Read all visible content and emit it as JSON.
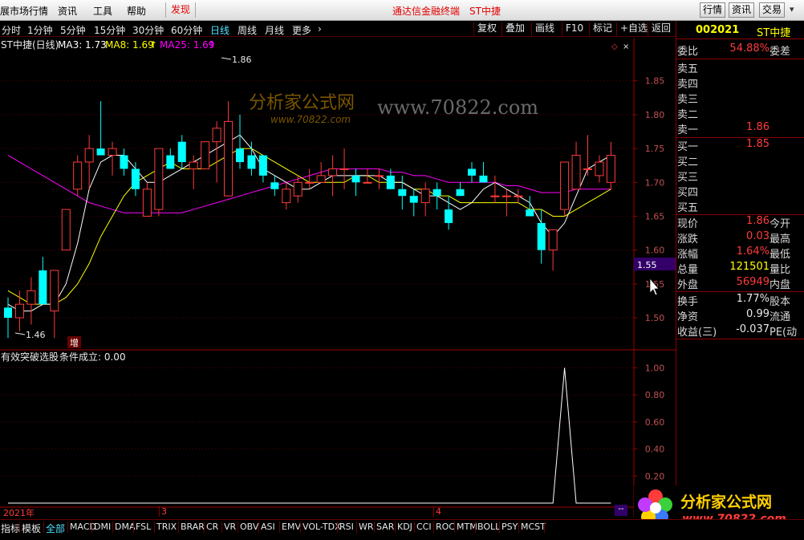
{
  "menu": {
    "items": [
      "展市场行情",
      "资讯",
      "工具",
      "帮助"
    ],
    "discover": "发现",
    "center_title": "通达信金融终端",
    "stock_tag": "ST中捷",
    "buttons": [
      "行情",
      "资讯",
      "交易"
    ]
  },
  "periods": {
    "items": [
      "分时",
      "1分钟",
      "5分钟",
      "15分钟",
      "30分钟",
      "60分钟",
      "日线",
      "周线",
      "月线",
      "更多"
    ],
    "selected": "日线",
    "more_arrow": "›"
  },
  "toolbar": {
    "items": [
      "复权",
      "叠加",
      "画线",
      "F10",
      "标记",
      "+自选",
      "返回"
    ]
  },
  "ma": {
    "title": "ST中捷(日线)",
    "ma3_label": "MA3: 1.73",
    "ma8_label": "MA8: 1.69",
    "ma25_label": "MA25: 1.69",
    "up_arrow": "↑"
  },
  "colors": {
    "up": "#ff3b3b",
    "down": "#00ffff",
    "ma3": "#ffffff",
    "ma8": "#ffff00",
    "ma25": "#ff00ff",
    "indicator": "#ffffff"
  },
  "price_axis": {
    "ticks": [
      "1.85",
      "1.80",
      "1.75",
      "1.70",
      "1.65",
      "1.60",
      "1.55",
      "1.50"
    ],
    "current_marker": "1.55"
  },
  "annotations": {
    "high": "1.86",
    "low": "1.46",
    "zeng": "增"
  },
  "watermark": {
    "text1": "分析家公式网",
    "text2": "www.70822.com",
    "text3": "www.70822.com"
  },
  "candles": [
    {
      "o": 1.515,
      "h": 1.53,
      "l": 1.47,
      "c": 1.5
    },
    {
      "o": 1.5,
      "h": 1.54,
      "l": 1.48,
      "c": 1.52
    },
    {
      "o": 1.52,
      "h": 1.56,
      "l": 1.49,
      "c": 1.54
    },
    {
      "o": 1.57,
      "h": 1.59,
      "l": 1.52,
      "c": 1.52
    },
    {
      "o": 1.51,
      "h": 1.57,
      "l": 1.47,
      "c": 1.57
    },
    {
      "o": 1.6,
      "h": 1.66,
      "l": 1.6,
      "c": 1.66
    },
    {
      "o": 1.69,
      "h": 1.74,
      "l": 1.68,
      "c": 1.73
    },
    {
      "o": 1.73,
      "h": 1.77,
      "l": 1.69,
      "c": 1.75
    },
    {
      "o": 1.75,
      "h": 1.82,
      "l": 1.74,
      "c": 1.74
    },
    {
      "o": 1.74,
      "h": 1.76,
      "l": 1.71,
      "c": 1.75
    },
    {
      "o": 1.74,
      "h": 1.75,
      "l": 1.71,
      "c": 1.72
    },
    {
      "o": 1.72,
      "h": 1.73,
      "l": 1.68,
      "c": 1.69
    },
    {
      "o": 1.65,
      "h": 1.7,
      "l": 1.65,
      "c": 1.69
    },
    {
      "o": 1.66,
      "h": 1.74,
      "l": 1.65,
      "c": 1.75
    },
    {
      "o": 1.74,
      "h": 1.75,
      "l": 1.72,
      "c": 1.72
    },
    {
      "o": 1.76,
      "h": 1.77,
      "l": 1.72,
      "c": 1.73
    },
    {
      "o": 1.72,
      "h": 1.74,
      "l": 1.69,
      "c": 1.73
    },
    {
      "o": 1.72,
      "h": 1.76,
      "l": 1.72,
      "c": 1.76
    },
    {
      "o": 1.76,
      "h": 1.79,
      "l": 1.7,
      "c": 1.78
    },
    {
      "o": 1.68,
      "h": 1.82,
      "l": 1.68,
      "c": 1.79
    },
    {
      "o": 1.75,
      "h": 1.8,
      "l": 1.72,
      "c": 1.73
    },
    {
      "o": 1.74,
      "h": 1.76,
      "l": 1.71,
      "c": 1.72
    },
    {
      "o": 1.74,
      "h": 1.74,
      "l": 1.7,
      "c": 1.71
    },
    {
      "o": 1.7,
      "h": 1.71,
      "l": 1.68,
      "c": 1.69
    },
    {
      "o": 1.67,
      "h": 1.7,
      "l": 1.66,
      "c": 1.69
    },
    {
      "o": 1.68,
      "h": 1.71,
      "l": 1.67,
      "c": 1.7
    },
    {
      "o": 1.7,
      "h": 1.72,
      "l": 1.69,
      "c": 1.7
    },
    {
      "o": 1.7,
      "h": 1.73,
      "l": 1.7,
      "c": 1.71
    },
    {
      "o": 1.71,
      "h": 1.74,
      "l": 1.68,
      "c": 1.72
    },
    {
      "o": 1.72,
      "h": 1.75,
      "l": 1.69,
      "c": 1.72
    },
    {
      "o": 1.71,
      "h": 1.72,
      "l": 1.68,
      "c": 1.7
    },
    {
      "o": 1.7,
      "h": 1.72,
      "l": 1.7,
      "c": 1.7
    },
    {
      "o": 1.71,
      "h": 1.72,
      "l": 1.69,
      "c": 1.71
    },
    {
      "o": 1.71,
      "h": 1.72,
      "l": 1.69,
      "c": 1.69
    },
    {
      "o": 1.69,
      "h": 1.71,
      "l": 1.66,
      "c": 1.68
    },
    {
      "o": 1.68,
      "h": 1.69,
      "l": 1.65,
      "c": 1.67
    },
    {
      "o": 1.67,
      "h": 1.7,
      "l": 1.65,
      "c": 1.69
    },
    {
      "o": 1.69,
      "h": 1.7,
      "l": 1.66,
      "c": 1.68
    },
    {
      "o": 1.66,
      "h": 1.68,
      "l": 1.63,
      "c": 1.64
    },
    {
      "o": 1.69,
      "h": 1.7,
      "l": 1.68,
      "c": 1.68
    },
    {
      "o": 1.72,
      "h": 1.73,
      "l": 1.7,
      "c": 1.71
    },
    {
      "o": 1.71,
      "h": 1.73,
      "l": 1.7,
      "c": 1.7
    },
    {
      "o": 1.68,
      "h": 1.71,
      "l": 1.67,
      "c": 1.68
    },
    {
      "o": 1.68,
      "h": 1.69,
      "l": 1.65,
      "c": 1.68
    },
    {
      "o": 1.68,
      "h": 1.69,
      "l": 1.67,
      "c": 1.68
    },
    {
      "o": 1.66,
      "h": 1.68,
      "l": 1.65,
      "c": 1.65
    },
    {
      "o": 1.64,
      "h": 1.66,
      "l": 1.58,
      "c": 1.6
    },
    {
      "o": 1.6,
      "h": 1.63,
      "l": 1.57,
      "c": 1.63
    },
    {
      "o": 1.66,
      "h": 1.73,
      "l": 1.65,
      "c": 1.73
    },
    {
      "o": 1.69,
      "h": 1.76,
      "l": 1.69,
      "c": 1.74
    },
    {
      "o": 1.72,
      "h": 1.77,
      "l": 1.71,
      "c": 1.72
    },
    {
      "o": 1.71,
      "h": 1.74,
      "l": 1.7,
      "c": 1.73
    },
    {
      "o": 1.7,
      "h": 1.76,
      "l": 1.69,
      "c": 1.74
    }
  ],
  "ma3_values": [
    1.52,
    1.51,
    1.51,
    1.52,
    1.52,
    1.55,
    1.61,
    1.69,
    1.73,
    1.74,
    1.74,
    1.72,
    1.7,
    1.7,
    1.71,
    1.72,
    1.73,
    1.74,
    1.75,
    1.76,
    1.77,
    1.75,
    1.72,
    1.71,
    1.7,
    1.69,
    1.69,
    1.7,
    1.71,
    1.71,
    1.71,
    1.71,
    1.71,
    1.7,
    1.7,
    1.69,
    1.68,
    1.68,
    1.67,
    1.66,
    1.67,
    1.69,
    1.7,
    1.69,
    1.68,
    1.67,
    1.64,
    1.62,
    1.64,
    1.68,
    1.72,
    1.73,
    1.74
  ],
  "ma8_values": [
    1.54,
    1.53,
    1.52,
    1.52,
    1.52,
    1.53,
    1.55,
    1.58,
    1.62,
    1.65,
    1.68,
    1.7,
    1.71,
    1.72,
    1.73,
    1.72,
    1.72,
    1.72,
    1.73,
    1.74,
    1.75,
    1.75,
    1.74,
    1.73,
    1.72,
    1.71,
    1.7,
    1.7,
    1.7,
    1.7,
    1.71,
    1.71,
    1.7,
    1.7,
    1.7,
    1.69,
    1.69,
    1.68,
    1.68,
    1.67,
    1.67,
    1.67,
    1.67,
    1.67,
    1.67,
    1.66,
    1.66,
    1.65,
    1.65,
    1.66,
    1.67,
    1.68,
    1.69
  ],
  "ma25_values": [
    1.74,
    1.73,
    1.72,
    1.71,
    1.7,
    1.69,
    1.68,
    1.67,
    1.665,
    1.66,
    1.655,
    1.655,
    1.655,
    1.655,
    1.655,
    1.655,
    1.66,
    1.665,
    1.67,
    1.675,
    1.68,
    1.685,
    1.69,
    1.695,
    1.7,
    1.705,
    1.71,
    1.715,
    1.72,
    1.72,
    1.72,
    1.72,
    1.72,
    1.715,
    1.715,
    1.71,
    1.71,
    1.705,
    1.7,
    1.7,
    1.7,
    1.7,
    1.7,
    1.695,
    1.695,
    1.69,
    1.685,
    1.685,
    1.685,
    1.69,
    1.69,
    1.69,
    1.69
  ],
  "indicator": {
    "title": "有效突破选股",
    "cond": "条件成立: 0.00",
    "ticks": [
      "1.00",
      "0.80",
      "0.60",
      "0.40",
      "0.20"
    ],
    "values": [
      0,
      0,
      0,
      0,
      0,
      0,
      0,
      0,
      0,
      0,
      0,
      0,
      0,
      0,
      0,
      0,
      0,
      0,
      0,
      0,
      0,
      0,
      0,
      0,
      0,
      0,
      0,
      0,
      0,
      0,
      0,
      0,
      0,
      0,
      0,
      0,
      0,
      0,
      0,
      0,
      0,
      0,
      0,
      0,
      0,
      0,
      0,
      0,
      1,
      0,
      0,
      0,
      0
    ]
  },
  "dates": {
    "year": "2021年",
    "m3": "3",
    "m4": "4",
    "dash": "--"
  },
  "quote": {
    "code": "002021",
    "name": "ST中捷",
    "weibi": {
      "label": "委比",
      "value": "54.88%",
      "label2": "委差"
    },
    "sell": [
      {
        "label": "卖五",
        "price": ""
      },
      {
        "label": "卖四",
        "price": ""
      },
      {
        "label": "卖三",
        "price": ""
      },
      {
        "label": "卖二",
        "price": ""
      },
      {
        "label": "卖一",
        "price": "1.86"
      }
    ],
    "buy": [
      {
        "label": "买一",
        "price": "1.85"
      },
      {
        "label": "买二",
        "price": ""
      },
      {
        "label": "买三",
        "price": ""
      },
      {
        "label": "买四",
        "price": ""
      },
      {
        "label": "买五",
        "price": ""
      }
    ],
    "stats": [
      {
        "k": "现价",
        "v": "1.86",
        "k2": "今开",
        "c": "#ff3b3b"
      },
      {
        "k": "涨跌",
        "v": "0.03",
        "k2": "最高",
        "c": "#ff3b3b"
      },
      {
        "k": "涨幅",
        "v": "1.64%",
        "k2": "最低",
        "c": "#ff3b3b"
      },
      {
        "k": "总量",
        "v": "121501",
        "k2": "量比",
        "c": "#ffff00"
      },
      {
        "k": "外盘",
        "v": "56949",
        "k2": "内盘",
        "c": "#ff3b3b"
      }
    ],
    "stats2": [
      {
        "k": "换手",
        "v": "1.77%",
        "k2": "股本",
        "c": "#e8e8e8"
      },
      {
        "k": "净资",
        "v": "0.99",
        "k2": "流通",
        "c": "#e8e8e8"
      },
      {
        "k": "收益(三)",
        "v": "-0.037",
        "k2": "PE(动",
        "c": "#e8e8e8"
      }
    ]
  },
  "bottom": {
    "tabs": [
      "指标",
      "模板",
      "全部",
      "MACD",
      "DMI",
      "DMA",
      "FSL",
      "TRIX",
      "BRAR",
      "CR",
      "VR",
      "OBV",
      "ASI",
      "EMV",
      "VOL-TDX",
      "RSI",
      "WR",
      "SAR",
      "KDJ",
      "CCI",
      "ROC",
      "MTM",
      "BOLL",
      "PSY",
      "MCST"
    ],
    "selected": "全部"
  },
  "logo": {
    "text": "分析家公式网",
    "url": "www.70822.com"
  }
}
